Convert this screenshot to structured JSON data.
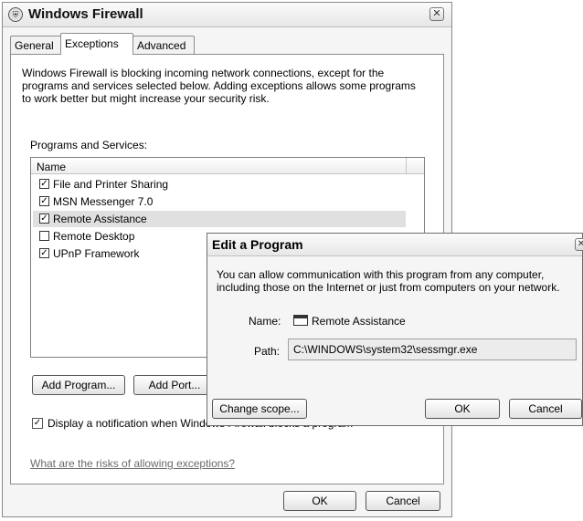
{
  "window": {
    "title": "Windows Firewall",
    "close_symbol": "✕",
    "icon": "firewall-icon"
  },
  "tabs": [
    {
      "label": "General",
      "active": false
    },
    {
      "label": "Exceptions",
      "active": true
    },
    {
      "label": "Advanced",
      "active": false
    }
  ],
  "exceptions": {
    "description": "Windows Firewall is blocking incoming network connections, except for the programs and services selected below. Adding exceptions allows some programs to work better but might increase your security risk.",
    "list_label": "Programs and Services:",
    "column_name": "Name",
    "items": [
      {
        "label": "File and Printer Sharing",
        "checked": true,
        "mark": "✓"
      },
      {
        "label": "MSN Messenger 7.0",
        "checked": true,
        "mark": "✓"
      },
      {
        "label": "Remote Assistance",
        "checked": true,
        "mark": "✓",
        "selected": true
      },
      {
        "label": "Remote Desktop",
        "checked": false,
        "mark": ""
      },
      {
        "label": "UPnP Framework",
        "checked": true,
        "mark": "✓"
      }
    ],
    "add_program_label": "Add Program...",
    "add_port_label": "Add Port...",
    "notify_checked": true,
    "notify_mark": "✓",
    "notify_label": "Display a notification when Windows Firewall blocks a program",
    "risks_link": "What are the risks of allowing exceptions?",
    "ok_label": "OK",
    "cancel_label": "Cancel"
  },
  "edit_dialog": {
    "title": "Edit a Program",
    "close_symbol": "✕",
    "description": "You can allow communication with this program from any computer, including those on the Internet or just from computers on your network.",
    "name_label": "Name:",
    "name_value": "Remote Assistance",
    "path_label": "Path:",
    "path_value": "C:\\WINDOWS\\system32\\sessmgr.exe",
    "change_scope_label": "Change scope...",
    "ok_label": "OK",
    "cancel_label": "Cancel"
  }
}
